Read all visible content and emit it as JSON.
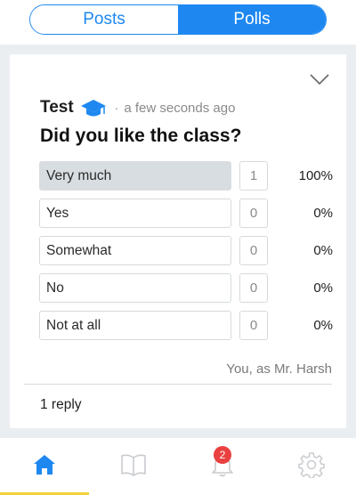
{
  "tabs": {
    "posts_label": "Posts",
    "polls_label": "Polls"
  },
  "post": {
    "author": "Test",
    "separator": "·",
    "time": "a few seconds ago",
    "question": "Did you like the class?",
    "options": [
      {
        "label": "Very much",
        "count": "1",
        "percent": "100%",
        "selected": true
      },
      {
        "label": "Yes",
        "count": "0",
        "percent": "0%",
        "selected": false
      },
      {
        "label": "Somewhat",
        "count": "0",
        "percent": "0%",
        "selected": false
      },
      {
        "label": "No",
        "count": "0",
        "percent": "0%",
        "selected": false
      },
      {
        "label": "Not at all",
        "count": "0",
        "percent": "0%",
        "selected": false
      }
    ],
    "byline": "You, as Mr. Harsh",
    "replies": "1 reply"
  },
  "nav": {
    "items": [
      "home-icon",
      "book-icon",
      "bell-icon",
      "gear-icon"
    ],
    "notification_badge": "2",
    "active_color": "#1e88f0",
    "inactive_color": "#c8cbce",
    "indicator_color": "#f2d43a"
  },
  "colors": {
    "accent": "#1e88f0",
    "badge": "#e94040",
    "selected_option_bg": "#d8dde1"
  }
}
